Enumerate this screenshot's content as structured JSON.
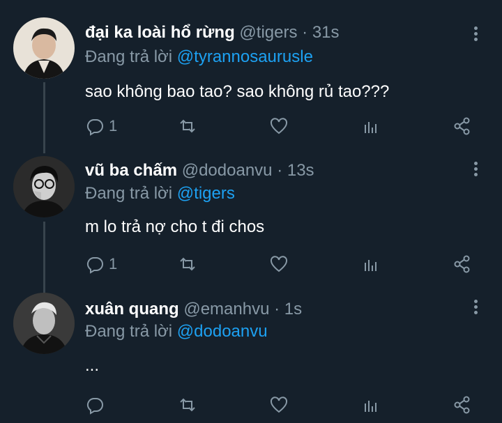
{
  "tweets": [
    {
      "name": "đại ka loài hổ rừng",
      "handle": "@tigers",
      "separator": "·",
      "time": "31s",
      "replying_prefix": "Đang trả lời",
      "replying_to": "@tyrannosaurusle",
      "text": "sao không bao tao? sao không rủ tao???",
      "reply_count": "1",
      "icons": [
        "reply-icon",
        "retweet-icon",
        "like-icon",
        "stats-icon",
        "share-icon"
      ]
    },
    {
      "name": "vũ ba chấm",
      "handle": "@dodoanvu",
      "separator": "·",
      "time": "13s",
      "replying_prefix": "Đang trả lời",
      "replying_to": "@tigers",
      "text": "m lo trả nợ cho t đi chos",
      "reply_count": "1",
      "icons": [
        "reply-icon",
        "retweet-icon",
        "like-icon",
        "stats-icon",
        "share-icon"
      ]
    },
    {
      "name": "xuân quang",
      "handle": "@emanhvu",
      "separator": "·",
      "time": "1s",
      "replying_prefix": "Đang trả lời",
      "replying_to": "@dodoanvu",
      "text": "...",
      "reply_count": "",
      "icons": [
        "reply-icon",
        "retweet-icon",
        "like-icon",
        "stats-icon",
        "share-icon"
      ]
    }
  ],
  "colors": {
    "background": "#15202b",
    "text": "#ffffff",
    "secondary": "#8899a6",
    "mention": "#1da1f2",
    "thread_line": "#38444d"
  }
}
